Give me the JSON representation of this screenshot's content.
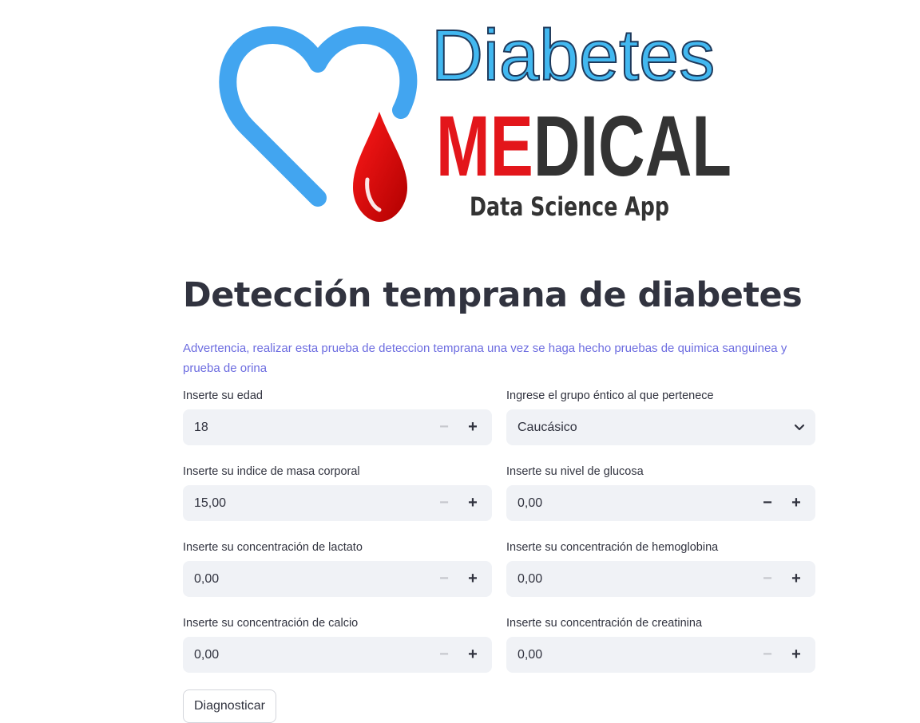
{
  "logo": {
    "line1": "Diabetes",
    "line2_red": "ME",
    "line2_dark": "DICAL",
    "line3": "Data Science App"
  },
  "page": {
    "title": "Detección temprana de diabetes",
    "warning": "Advertencia, realizar esta prueba de deteccion temprana una vez se haga hecho pruebas de quimica sanguinea y prueba de orina"
  },
  "form": {
    "age": {
      "label": "Inserte su edad",
      "value": "18"
    },
    "ethnic": {
      "label": "Ingrese el grupo éntico al que pertenece",
      "value": "Caucásico"
    },
    "bmi": {
      "label": "Inserte su indice de masa corporal",
      "value": "15,00"
    },
    "glucose": {
      "label": "Inserte su nivel de glucosa",
      "value": "0,00"
    },
    "lactate": {
      "label": "Inserte su concentración de lactato",
      "value": "0,00"
    },
    "hemoglobin": {
      "label": "Inserte su concentración de hemoglobina",
      "value": "0,00"
    },
    "calcium": {
      "label": "Inserte su concentración de calcio",
      "value": "0,00"
    },
    "creatinine": {
      "label": "Inserte su concentración de creatinina",
      "value": "0,00"
    },
    "minus_symbol": "−",
    "plus_symbol": "+"
  },
  "actions": {
    "diagnose_label": "Diagnosticar"
  },
  "colors": {
    "accent_blue": "#3fa9f5",
    "accent_red": "#e3161b",
    "warning_text": "#6c6ce0",
    "input_bg": "#f0f2f6"
  }
}
